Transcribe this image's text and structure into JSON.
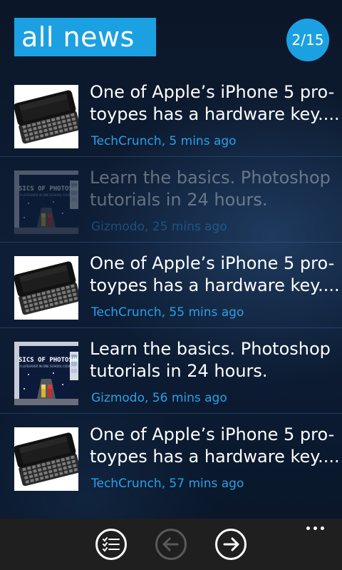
{
  "header": {
    "title": "all news",
    "page_counter": "2/15"
  },
  "news_items": [
    {
      "headline_line1": "One of Apple’s iPhone 5 pro-",
      "headline_line2": "toypes has a hardware key....",
      "source": "TechCrunch, 5 mins ago",
      "thumbnail": "iphone-slider-keyboard",
      "read": false
    },
    {
      "headline_line1": "Learn the basics. Photoshop",
      "headline_line2": "tutorials in 24 hours.",
      "source": "Gizmodo, 25 mins ago",
      "thumbnail": "photoshop-basics",
      "read": true
    },
    {
      "headline_line1": "One of Apple’s iPhone 5 pro-",
      "headline_line2": "toypes has a hardware key....",
      "source": "TechCrunch, 55 mins ago",
      "thumbnail": "iphone-slider-keyboard",
      "read": false
    },
    {
      "headline_line1": "Learn the basics. Photoshop",
      "headline_line2": "tutorials in 24 hours.",
      "source": "Gizmodo, 56 mins ago",
      "thumbnail": "photoshop-basics",
      "read": false
    },
    {
      "headline_line1": "One of Apple’s iPhone 5 pro-",
      "headline_line2": "toypes has a hardware key....",
      "source": "TechCrunch, 57 mins ago",
      "thumbnail": "iphone-slider-keyboard",
      "read": false
    }
  ],
  "app_bar": {
    "buttons": [
      {
        "icon": "list-icon",
        "enabled": true
      },
      {
        "icon": "back-arrow-icon",
        "enabled": false
      },
      {
        "icon": "forward-arrow-icon",
        "enabled": true
      }
    ],
    "more_icon": "ellipsis-icon"
  },
  "colors": {
    "accent": "#1ba1e2",
    "source_text": "#2aa0e8",
    "app_bar": "#1f1f1f"
  }
}
